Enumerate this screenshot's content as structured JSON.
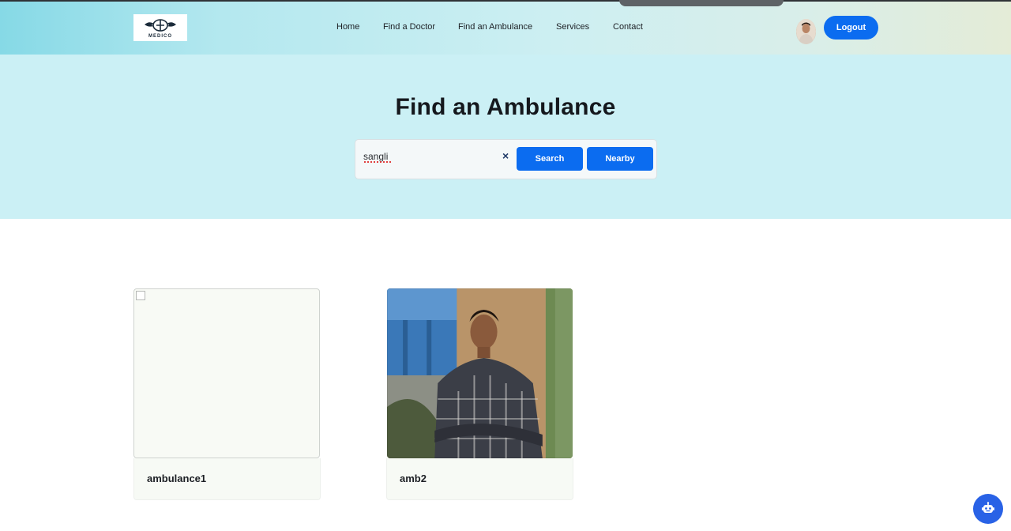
{
  "header": {
    "logo_text": "MEDICO",
    "nav": [
      "Home",
      "Find a Doctor",
      "Find an Ambulance",
      "Services",
      "Contact"
    ],
    "logout_label": "Logout"
  },
  "hero": {
    "title": "Find an Ambulance",
    "search": {
      "value": "sangli",
      "placeholder": ""
    },
    "clear_glyph": "×",
    "search_label": "Search",
    "nearby_label": "Nearby"
  },
  "cards": [
    {
      "name": "ambulance1",
      "image": "broken-image"
    },
    {
      "name": "amb2",
      "image": "person-photo"
    }
  ],
  "colors": {
    "accent": "#0b6cf0",
    "hero_bg": "#cbf0f5",
    "chatbot": "#2962e6"
  },
  "icons": {
    "clear": "close-icon",
    "chatbot": "robot-icon"
  }
}
